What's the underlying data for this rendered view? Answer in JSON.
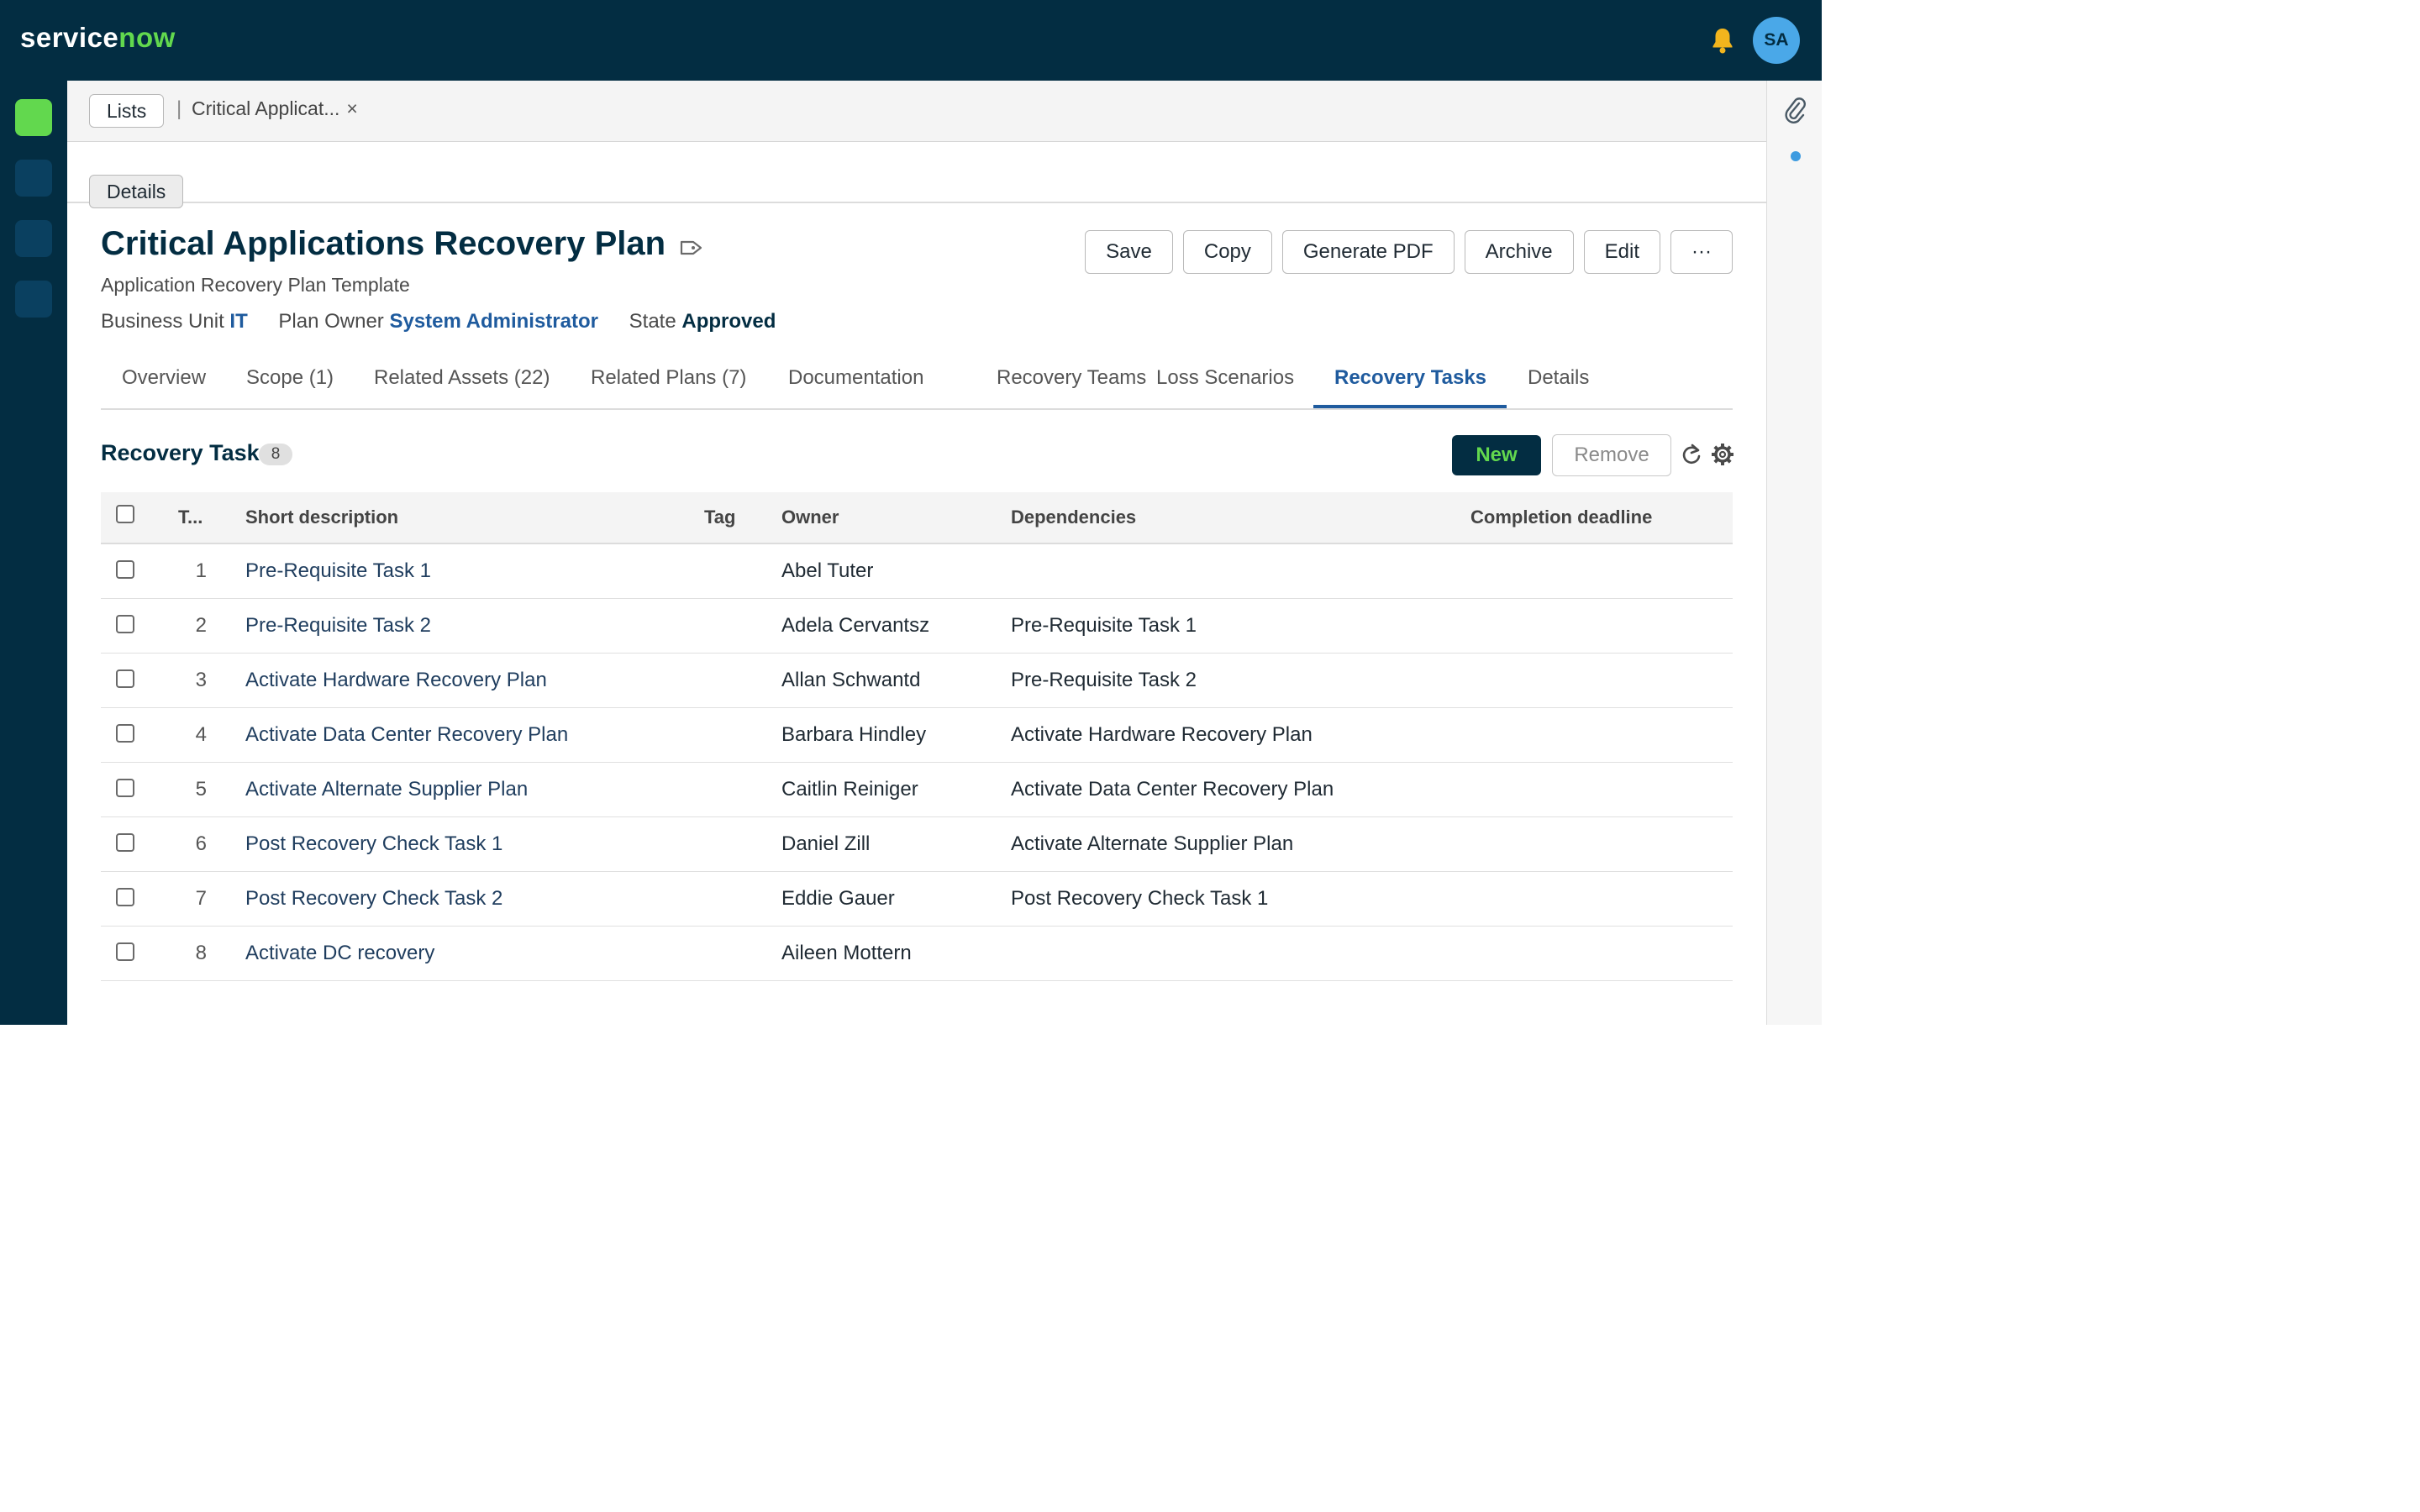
{
  "header": {
    "logo_part1": "service",
    "logo_part2": "now",
    "avatar_initials": "SA",
    "icons": [
      "bell-icon"
    ],
    "colors": {
      "topbar": "#032d42",
      "brand_green": "#62d84e",
      "avatar": "#4aa8e8"
    }
  },
  "breadcrumbs": {
    "lists_label": "Lists",
    "separator": "|",
    "tab_label": "Critical Applicat...",
    "close_glyph": "×"
  },
  "subnav": {
    "details_label": "Details"
  },
  "record": {
    "title": "Critical Applications Recovery Plan",
    "subtitle": "Application Recovery Plan Template",
    "business_unit_label": "Business Unit",
    "business_unit_value": "IT",
    "plan_owner_label": "Plan Owner",
    "plan_owner_value": "System Administrator",
    "state_label": "State",
    "state_value": "Approved"
  },
  "actions": {
    "save": "Save",
    "copy": "Copy",
    "generate_pdf": "Generate PDF",
    "archive": "Archive",
    "edit": "Edit",
    "more": "···"
  },
  "tabs": [
    {
      "label": "Overview"
    },
    {
      "label": "Scope (1)"
    },
    {
      "label": "Related Assets (22)"
    },
    {
      "label": "Related Plans (7)"
    },
    {
      "label": "Documentation"
    },
    {
      "label": "Recovery Teams"
    },
    {
      "label": "Loss Scenarios"
    },
    {
      "label": "Recovery Tasks",
      "active": true
    },
    {
      "label": "Details"
    }
  ],
  "related_list": {
    "title": "Recovery Task",
    "count": "8",
    "new_label": "New",
    "remove_label": "Remove",
    "columns": [
      "T...",
      "Short description",
      "Tag",
      "Owner",
      "Dependencies",
      "Completion deadline"
    ],
    "rows": [
      {
        "order": "1",
        "short_description": "Pre-Requisite Task 1",
        "tag": "",
        "owner": "Abel Tuter",
        "dependencies": "",
        "deadline": ""
      },
      {
        "order": "2",
        "short_description": "Pre-Requisite Task 2",
        "tag": "",
        "owner": "Adela Cervantsz",
        "dependencies": "Pre-Requisite Task 1",
        "deadline": ""
      },
      {
        "order": "3",
        "short_description": "Activate Hardware Recovery Plan",
        "tag": "",
        "owner": "Allan Schwantd",
        "dependencies": "Pre-Requisite Task 2",
        "deadline": ""
      },
      {
        "order": "4",
        "short_description": "Activate Data Center Recovery Plan",
        "tag": "",
        "owner": "Barbara Hindley",
        "dependencies": "Activate Hardware Recovery Plan",
        "deadline": ""
      },
      {
        "order": "5",
        "short_description": "Activate Alternate Supplier Plan",
        "tag": "",
        "owner": "Caitlin Reiniger",
        "dependencies": "Activate Data Center Recovery Plan",
        "deadline": ""
      },
      {
        "order": "6",
        "short_description": "Post Recovery Check Task 1",
        "tag": "",
        "owner": "Daniel Zill",
        "dependencies": "Activate Alternate Supplier Plan",
        "deadline": ""
      },
      {
        "order": "7",
        "short_description": "Post Recovery Check Task 2",
        "tag": "",
        "owner": "Eddie Gauer",
        "dependencies": "Post Recovery Check Task 1",
        "deadline": ""
      },
      {
        "order": "8",
        "short_description": "Activate DC recovery",
        "tag": "",
        "owner": "Aileen Mottern",
        "dependencies": "",
        "deadline": ""
      }
    ]
  }
}
